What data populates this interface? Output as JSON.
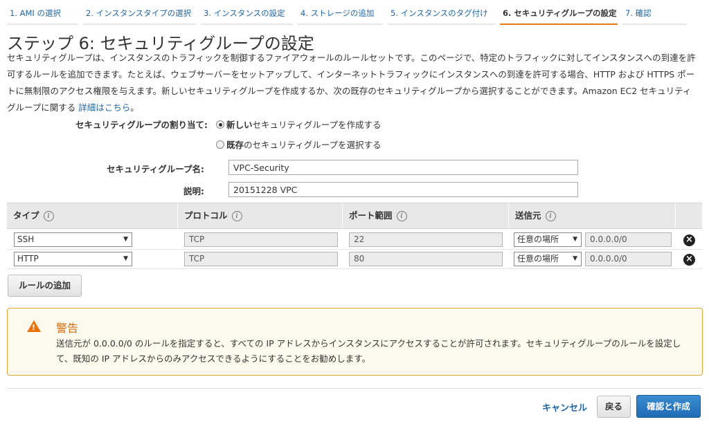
{
  "steps": [
    {
      "label": "1. AMI の選択"
    },
    {
      "label": "2. インスタンスタイプの選択"
    },
    {
      "label": "3. インスタンスの設定"
    },
    {
      "label": "4. ストレージの追加"
    },
    {
      "label": "5. インスタンスのタグ付け"
    },
    {
      "label": "6. セキュリティグループの設定"
    },
    {
      "label": "7. 確認"
    }
  ],
  "page_title": "ステップ 6: セキュリティグループの設定",
  "description": {
    "text": "セキュリティグループは、インスタンスのトラフィックを制御するファイアウォールのルールセットです。このページで、特定のトラフィックに対してインスタンスへの到達を許可するルールを追加できます。たとえば、ウェブサーバーをセットアップして、インターネットトラフィックにインスタンスへの到達を許可する場合、HTTP および HTTPS ポートに無制限のアクセス権限を与えます。新しいセキュリティグループを作成するか、次の既存のセキュリティグループから選択することができます。Amazon EC2 セキュリティグループに関する ",
    "link": "詳細はこちら",
    "end": "。"
  },
  "assign": {
    "label": "セキュリティグループの割り当て:",
    "option_new_bold": "新しい",
    "option_new_rest": "セキュリティグループを作成する",
    "option_existing_bold": "既存",
    "option_existing_rest": "のセキュリティグループを選択する",
    "selected": "new"
  },
  "group_name": {
    "label": "セキュリティグループ名:",
    "value": "VPC-Security"
  },
  "group_desc": {
    "label": "説明:",
    "value": "20151228 VPC"
  },
  "table": {
    "headers": [
      "タイプ",
      "プロトコル",
      "ポート範囲",
      "送信元"
    ],
    "info_glyph": "i",
    "rows": [
      {
        "type": "SSH",
        "protocol": "TCP",
        "port": "22",
        "source": "任意の場所",
        "cidr": "0.0.0.0/0"
      },
      {
        "type": "HTTP",
        "protocol": "TCP",
        "port": "80",
        "source": "任意の場所",
        "cidr": "0.0.0.0/0"
      }
    ]
  },
  "add_rule_label": "ルールの追加",
  "warning": {
    "title": "警告",
    "text": "送信元が 0.0.0.0/0 のルールを指定すると、すべての IP アドレスからインスタンスにアクセスすることが許可されます。セキュリティグループのルールを設定して、既知の IP アドレスからのみアクセスできるようにすることをお勧めします。",
    "icon_glyph": "!"
  },
  "footer": {
    "cancel": "キャンセル",
    "back": "戻る",
    "confirm": "確認と作成"
  },
  "glyphs": {
    "dropdown": "▼",
    "remove": "×"
  },
  "colors": {
    "link": "#1f66a6",
    "active_step_underline": "#e47911",
    "warning_border": "#e8a33b",
    "warning_title": "#d66b0a",
    "primary_button": "#1f6db5"
  }
}
